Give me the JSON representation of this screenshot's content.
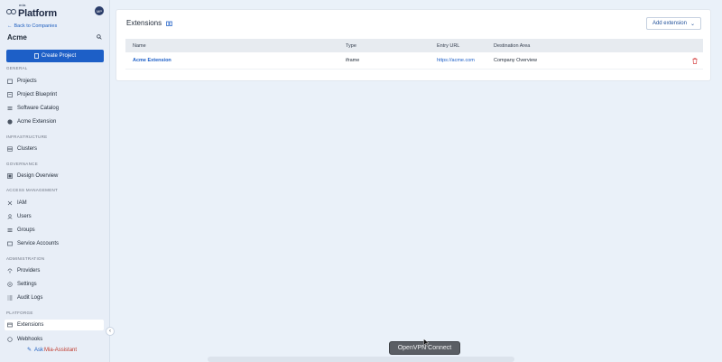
{
  "brand": {
    "prefix": "mia",
    "name": "Platform",
    "avatar_initials": "MP"
  },
  "sidebar": {
    "back_label": "Back to Companies",
    "company": "Acme",
    "create_project": "Create Project",
    "sections": [
      {
        "label": "GENERAL",
        "items": [
          {
            "label": "Projects",
            "icon": "folder-icon"
          },
          {
            "label": "Project Blueprint",
            "icon": "blueprint-icon"
          },
          {
            "label": "Software Catalog",
            "icon": "catalog-icon"
          },
          {
            "label": "Acme Extension",
            "icon": "globe-icon"
          }
        ]
      },
      {
        "label": "INFRASTRUCTURE",
        "items": [
          {
            "label": "Clusters",
            "icon": "cluster-icon"
          }
        ]
      },
      {
        "label": "GOVERNANCE",
        "items": [
          {
            "label": "Design Overview",
            "icon": "design-icon"
          }
        ]
      },
      {
        "label": "ACCESS MANAGEMENT",
        "items": [
          {
            "label": "IAM",
            "icon": "key-icon"
          },
          {
            "label": "Users",
            "icon": "user-icon"
          },
          {
            "label": "Groups",
            "icon": "group-icon"
          },
          {
            "label": "Service Accounts",
            "icon": "service-account-icon"
          }
        ]
      },
      {
        "label": "ADMINISTRATION",
        "items": [
          {
            "label": "Providers",
            "icon": "provider-icon"
          },
          {
            "label": "Settings",
            "icon": "gear-icon"
          },
          {
            "label": "Audit Logs",
            "icon": "list-icon"
          }
        ]
      },
      {
        "label": "PLATFORGE",
        "items": [
          {
            "label": "Extensions",
            "icon": "extension-icon",
            "active": true
          },
          {
            "label": "Webhooks",
            "icon": "webhook-icon"
          }
        ]
      }
    ],
    "ask_prefix": "Ask ",
    "ask_highlight": "Mia-Assistant"
  },
  "main": {
    "title": "Extensions",
    "add_button": "Add extension",
    "columns": [
      "Name",
      "Type",
      "Entry URL",
      "Destination Area"
    ],
    "rows": [
      {
        "name": "Acme Extension",
        "type": "iframe",
        "url": "https://acme.com",
        "area": "Company Overview"
      }
    ]
  },
  "tooltip": "OpenVPN Connect"
}
